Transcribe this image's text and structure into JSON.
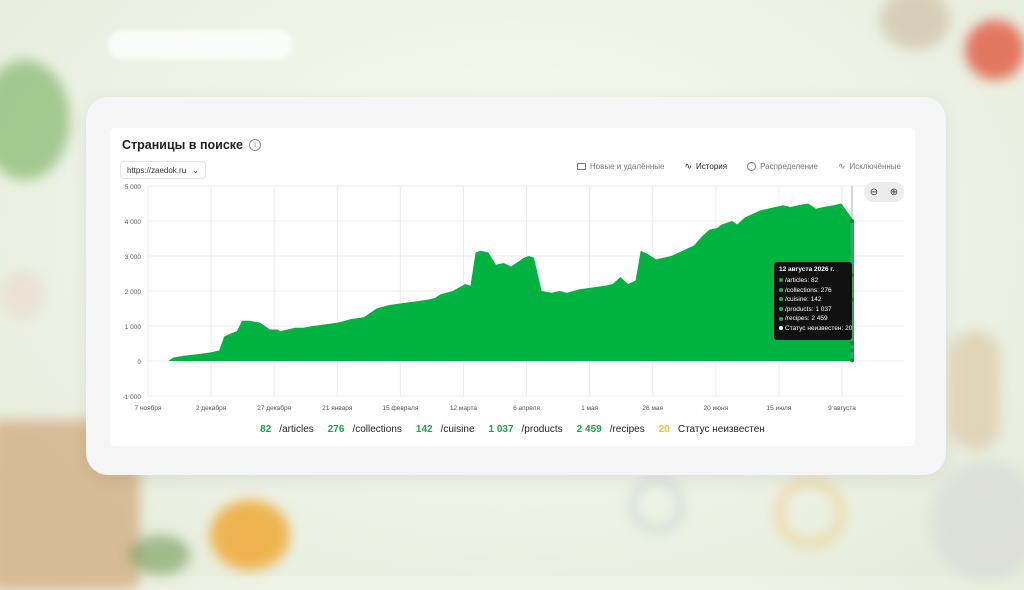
{
  "colors": {
    "accent": "#00b341",
    "unknown": "#f0c419",
    "tooltip_bg": "#111111"
  },
  "panel": {
    "title": "Страницы в поиске",
    "info_icon": "info-icon",
    "site_selector": "https://zaedok.ru"
  },
  "tabs": [
    {
      "label": "Новые и удалённые",
      "icon": "image-icon"
    },
    {
      "label": "История",
      "icon": "chart-line-icon",
      "active": true
    },
    {
      "label": "Распределение",
      "icon": "pie-icon"
    },
    {
      "label": "Исключённые",
      "icon": "excluded-chart-icon"
    }
  ],
  "zoom": {
    "zoom_out": "zoom-out-icon",
    "zoom_in": "zoom-in-icon"
  },
  "tooltip": {
    "title": "12 августа 2026 г.",
    "rows": [
      "/articles: 82",
      "/collections: 276",
      "/cuisine: 142",
      "/products: 1 037",
      "/recipes: 2 459",
      "Статус неизвестен: 20"
    ]
  },
  "legend": [
    {
      "value": "82",
      "label": "/articles"
    },
    {
      "value": "276",
      "label": "/collections"
    },
    {
      "value": "142",
      "label": "/cuisine"
    },
    {
      "value": "1 037",
      "label": "/products"
    },
    {
      "value": "2 459",
      "label": "/recipes"
    },
    {
      "value": "20",
      "label": "Статус неизвестен",
      "unknown": true
    }
  ],
  "chart_data": {
    "type": "area",
    "ylim": [
      -1000,
      5000
    ],
    "y_ticks": [
      5000,
      4000,
      3000,
      2000,
      1000,
      0,
      -1000
    ],
    "y_tick_labels": [
      "5 000",
      "4 000",
      "3 000",
      "2 000",
      "1 000",
      "0",
      "-1 000"
    ],
    "x_ticks": [
      "7 ноября",
      "2 декабря",
      "27 декабря",
      "21 января",
      "15 февраля",
      "12 марта",
      "6 апреля",
      "1 мая",
      "26 мая",
      "20 июня",
      "15 июля",
      "9 августа"
    ],
    "grid": true,
    "x": [
      0,
      8,
      10,
      14,
      20,
      25,
      28,
      30,
      33,
      35,
      37,
      40,
      44,
      48,
      51,
      52,
      55,
      58,
      61,
      65,
      70,
      75,
      80,
      85,
      90,
      95,
      100,
      105,
      110,
      113,
      115,
      120,
      125,
      127,
      129,
      131,
      134,
      137,
      140,
      143,
      146,
      148,
      150,
      152,
      155,
      159,
      162,
      165,
      170,
      175,
      180,
      183,
      186,
      189,
      192,
      194,
      197,
      200,
      203,
      206,
      209,
      212,
      215,
      218,
      221,
      224,
      226,
      228,
      230,
      232,
      235,
      238,
      241,
      244,
      247,
      250,
      253,
      256,
      260,
      263,
      266,
      270,
      273,
      276,
      278
    ],
    "values": [
      0,
      0,
      100,
      150,
      200,
      250,
      300,
      700,
      800,
      850,
      1150,
      1150,
      1100,
      900,
      900,
      850,
      900,
      950,
      950,
      1000,
      1050,
      1100,
      1200,
      1250,
      1500,
      1600,
      1650,
      1700,
      1750,
      1800,
      1900,
      2000,
      2200,
      2150,
      3100,
      3150,
      3100,
      2750,
      2800,
      2700,
      2850,
      2950,
      3000,
      2950,
      2000,
      1950,
      2000,
      1950,
      2050,
      2100,
      2150,
      2200,
      2400,
      2200,
      2300,
      3150,
      3050,
      2900,
      2950,
      3000,
      3100,
      3200,
      3300,
      3550,
      3750,
      3800,
      3900,
      3950,
      4000,
      3900,
      4100,
      4200,
      4300,
      4350,
      4400,
      4450,
      4400,
      4450,
      4500,
      4350,
      4400,
      4450,
      4500,
      4200,
      4000
    ],
    "series": [
      {
        "name": "/articles",
        "last": 82
      },
      {
        "name": "/collections",
        "last": 276
      },
      {
        "name": "/cuisine",
        "last": 142
      },
      {
        "name": "/products",
        "last": 1037
      },
      {
        "name": "/recipes",
        "last": 2459
      },
      {
        "name": "Статус неизвестен",
        "last": 20
      }
    ],
    "hover_markers": [
      4000,
      2459,
      1750,
      500,
      300,
      20
    ]
  }
}
